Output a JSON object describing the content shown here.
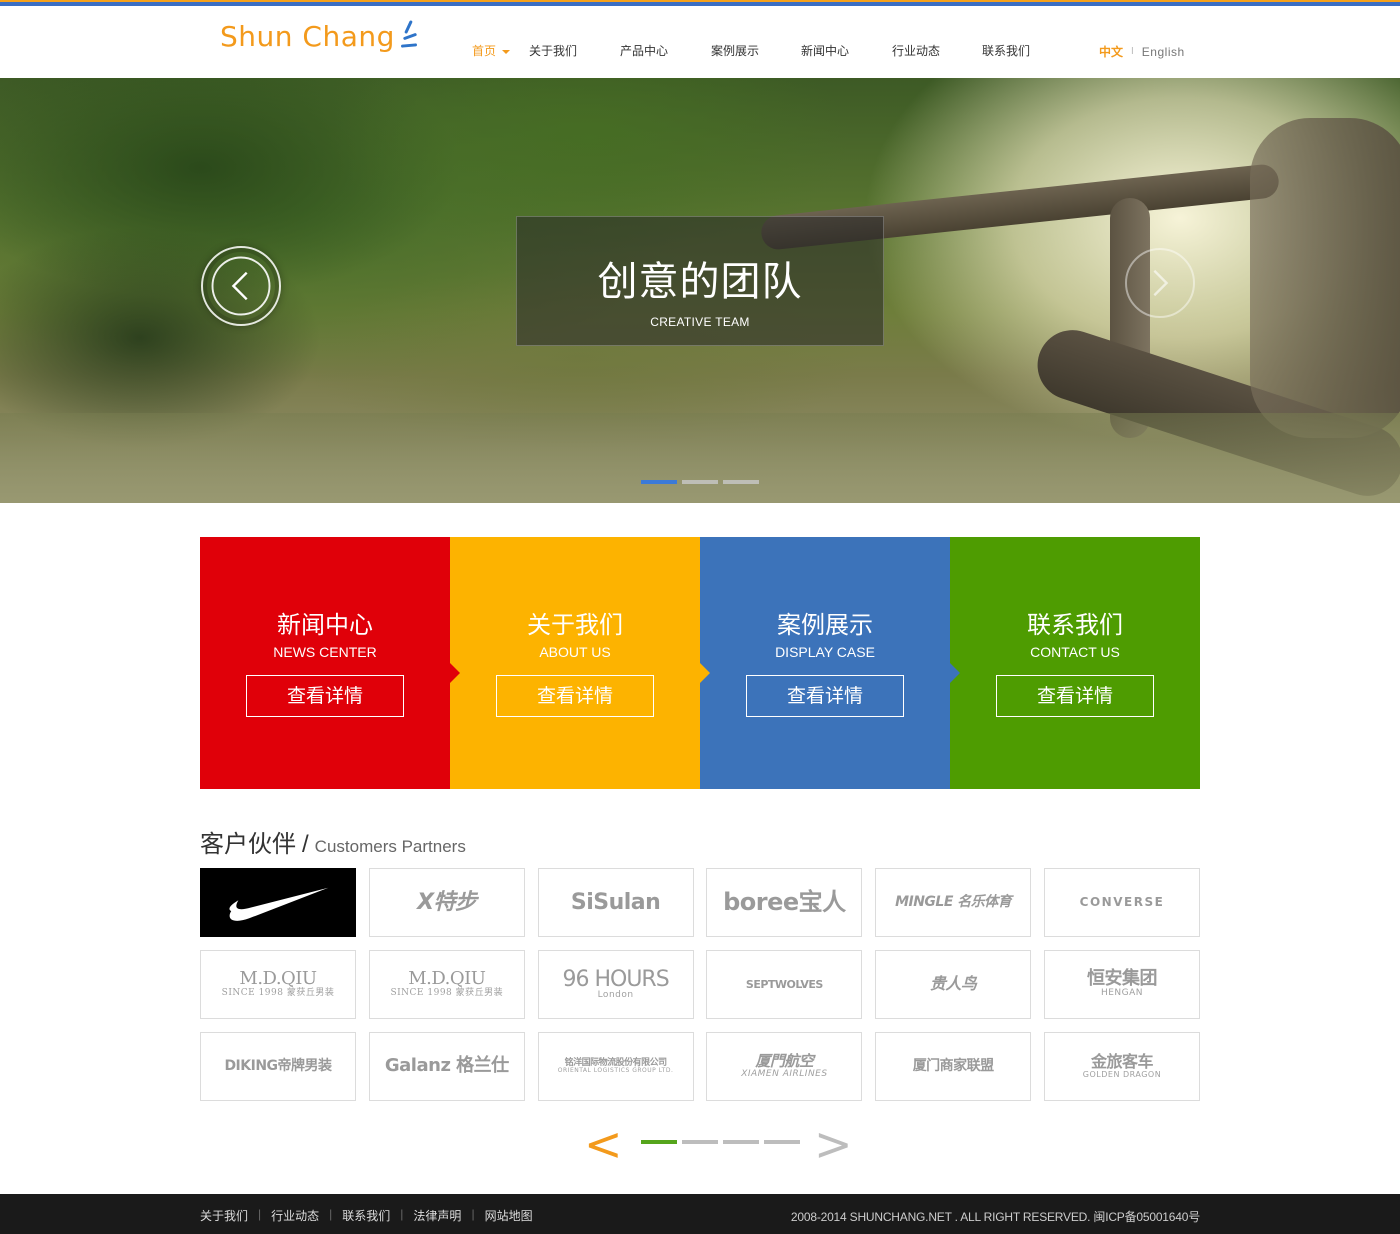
{
  "brand": {
    "logo_text": "Shun Chang",
    "colors": {
      "orange": "#f39a1c",
      "blue": "#3b6fc4"
    }
  },
  "nav": {
    "items": [
      {
        "label": "首页",
        "active": true
      },
      {
        "label": "关于我们"
      },
      {
        "label": "产品中心"
      },
      {
        "label": "案例展示"
      },
      {
        "label": "新闻中心"
      },
      {
        "label": "行业动态"
      },
      {
        "label": "联系我们"
      }
    ]
  },
  "lang": {
    "zh": "中文",
    "sep": "I",
    "en": "English"
  },
  "hero": {
    "title": "创意的团队",
    "subtitle": "CREATIVE TEAM",
    "slides_total": 3,
    "active_slide": 1
  },
  "features": [
    {
      "title": "新闻中心",
      "subtitle": "NEWS CENTER",
      "button": "查看详情",
      "color": "#e00009"
    },
    {
      "title": "关于我们",
      "subtitle": "ABOUT US",
      "button": "查看详情",
      "color": "#fdb300"
    },
    {
      "title": "案例展示",
      "subtitle": "DISPLAY CASE",
      "button": "查看详情",
      "color": "#3c73ba"
    },
    {
      "title": "联系我们",
      "subtitle": "CONTACT US",
      "button": "查看详情",
      "color": "#4e9c01"
    }
  ],
  "partners": {
    "title": "客户伙伴",
    "sep": "/",
    "subtitle": "Customers Partners",
    "logos": [
      {
        "name": "nike",
        "icon": "nike-swoosh-icon",
        "text": ""
      },
      {
        "name": "xtep",
        "text": "X特步"
      },
      {
        "name": "sisulan",
        "text": "SiSulan"
      },
      {
        "name": "boree",
        "text": "boree宝人"
      },
      {
        "name": "mingle",
        "text": "MINGLE 名乐体育"
      },
      {
        "name": "converse",
        "text": "CONVERSE"
      },
      {
        "name": "mdqiu-1",
        "text": "M.D.QIU",
        "sub": "SINCE 1998 蒙获丘男装"
      },
      {
        "name": "mdqiu-2",
        "text": "M.D.QIU",
        "sub": "SINCE 1998 蒙获丘男装"
      },
      {
        "name": "96hours",
        "text": "96 HOURS",
        "sub": "London"
      },
      {
        "name": "septwolves",
        "text": "SEPTWOLVES"
      },
      {
        "name": "guirenniao",
        "text": "贵人鸟"
      },
      {
        "name": "hengan",
        "text": "恒安集团",
        "sub": "HENGAN"
      },
      {
        "name": "diking",
        "text": "DIKING帝牌男装"
      },
      {
        "name": "galanz",
        "text": "Galanz 格兰仕"
      },
      {
        "name": "oriental-logistics",
        "text": "铭洋国际物流股份有限公司",
        "sub": "ORIENTAL LOGISTICS GROUP LTD."
      },
      {
        "name": "xiamen-airlines",
        "text": "厦門航空",
        "sub": "XIAMEN AIRLINES"
      },
      {
        "name": "xiamen-business",
        "text": "厦门商家联盟"
      },
      {
        "name": "golden-dragon",
        "text": "金旅客车",
        "sub": "GOLDEN DRAGON"
      }
    ],
    "pager": {
      "prev": "<",
      "next": ">",
      "pages": 4,
      "active": 1
    }
  },
  "footer": {
    "links": [
      "关于我们",
      "行业动态",
      "联系我们",
      "法律声明",
      "网站地图"
    ],
    "sep": "|",
    "copyright": "2008-2014 SHUNCHANG.NET . ALL RIGHT RESERVED. 闽ICP备05001640号"
  }
}
